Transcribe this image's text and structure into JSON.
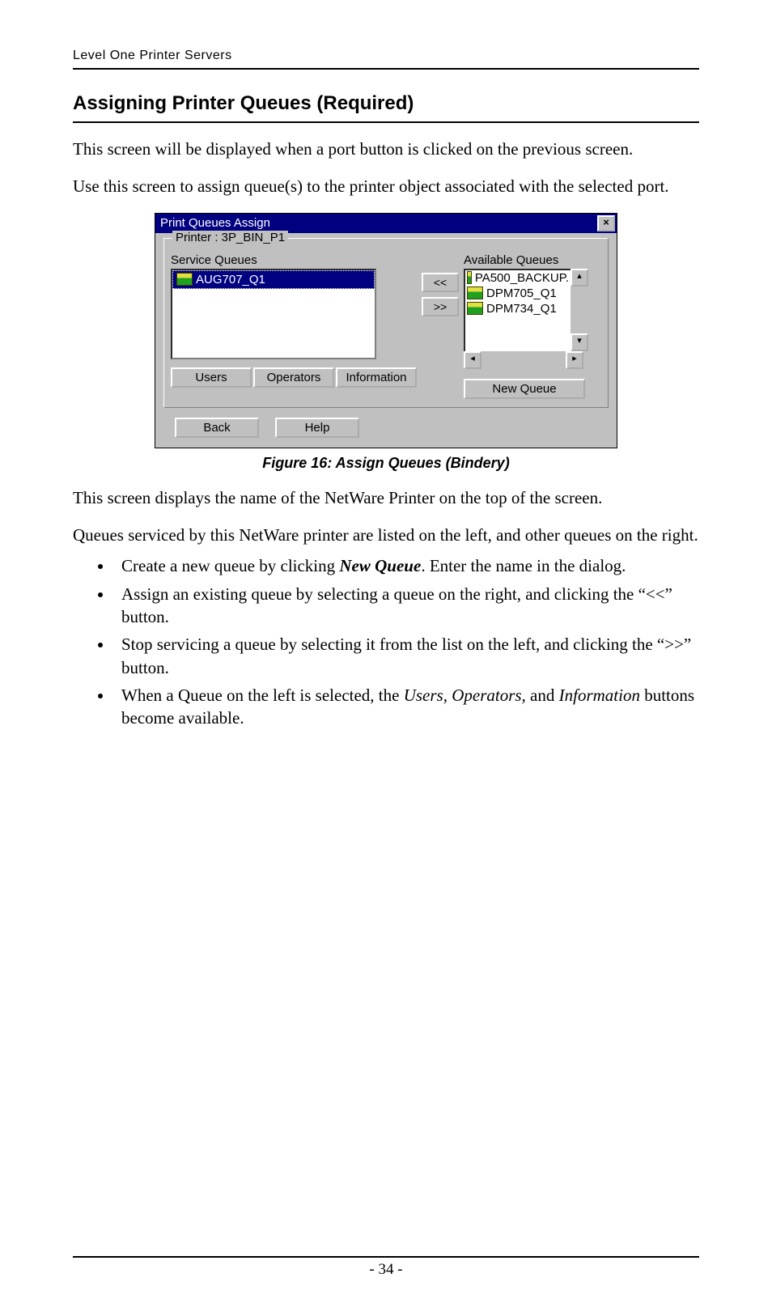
{
  "header": "Level One Printer Servers",
  "section_title": "Assigning Printer Queues (Required)",
  "intro_1": "This screen will be displayed when a port button is clicked on the previous screen.",
  "intro_2": "Use this screen to assign queue(s) to the printer object associated with the selected port.",
  "dialog": {
    "title": "Print Queues Assign",
    "close": "×",
    "group_label": "Printer :  3P_BIN_P1",
    "left_label": "Service Queues",
    "left_items": [
      "AUG707_Q1"
    ],
    "right_label": "Available Queues",
    "right_items": [
      "PA500_BACKUP.",
      "DPM705_Q1",
      "DPM734_Q1"
    ],
    "move_in": "<<",
    "move_out": ">>",
    "btn_users": "Users",
    "btn_operators": "Operators",
    "btn_information": "Information",
    "btn_new_queue": "New Queue",
    "btn_back": "Back",
    "btn_help": "Help",
    "scroll_up": "▴",
    "scroll_down": "▾",
    "scroll_left": "◂",
    "scroll_right": "▸"
  },
  "figure_caption": "Figure 16: Assign Queues (Bindery)",
  "para_1": "This screen displays the name of the NetWare Printer on the top of the screen.",
  "para_2": "Queues serviced by this NetWare printer are listed on the left, and other queues on the right.",
  "bullets": {
    "b1_pre": "Create a new queue by clicking ",
    "b1_em": "New Queue",
    "b1_post": ". Enter the name in the dialog.",
    "b2": "Assign an existing queue by selecting a queue on the right, and clicking the “<<” button.",
    "b3": "Stop servicing a queue by selecting it from the list on the left, and clicking the “>>” button.",
    "b4_pre": "When a Queue on the left is selected, the ",
    "b4_em": "Users, Operators,",
    "b4_mid": " and ",
    "b4_em2": "Information",
    "b4_post": " buttons become available."
  },
  "page_number": "- 34 -"
}
